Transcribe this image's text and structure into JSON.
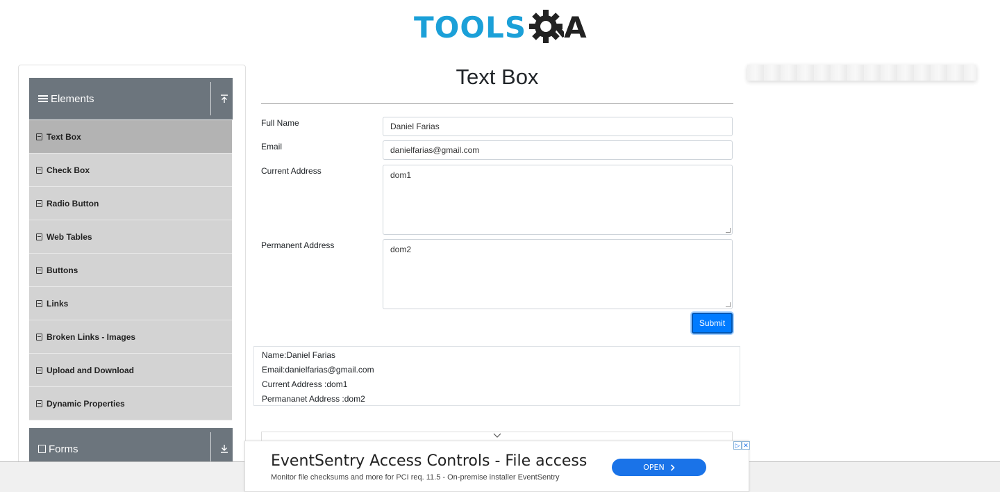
{
  "header": {
    "logo_text": "TOOLS",
    "logo_suffix": "A"
  },
  "sidebar": {
    "group_elements": "Elements",
    "items": [
      {
        "label": "Text Box"
      },
      {
        "label": "Check Box"
      },
      {
        "label": "Radio Button"
      },
      {
        "label": "Web Tables"
      },
      {
        "label": "Buttons"
      },
      {
        "label": "Links"
      },
      {
        "label": "Broken Links - Images"
      },
      {
        "label": "Upload and Download"
      },
      {
        "label": "Dynamic Properties"
      }
    ],
    "group_forms": "Forms"
  },
  "main": {
    "title": "Text Box",
    "full_name_label": "Full Name",
    "full_name_value": "Daniel Farias",
    "email_label": "Email",
    "email_value": "danielfarias@gmail.com",
    "current_address_label": "Current Address",
    "current_address_value": "dom1",
    "permanent_address_label": "Permanent Address",
    "permanent_address_value": "dom2",
    "submit_label": "Submit"
  },
  "output": {
    "name": "Name:Daniel Farias",
    "email": "Email:danielfarias@gmail.com",
    "current_address": "Current Address :dom1",
    "permanent_address": "Permananet Address :dom2"
  },
  "ad": {
    "title": "EventSentry Access Controls - File access",
    "subtitle": "Monitor file checksums and more for PCI req. 11.5 - On-premise installer EventSentry",
    "open_label": "OPEN"
  }
}
